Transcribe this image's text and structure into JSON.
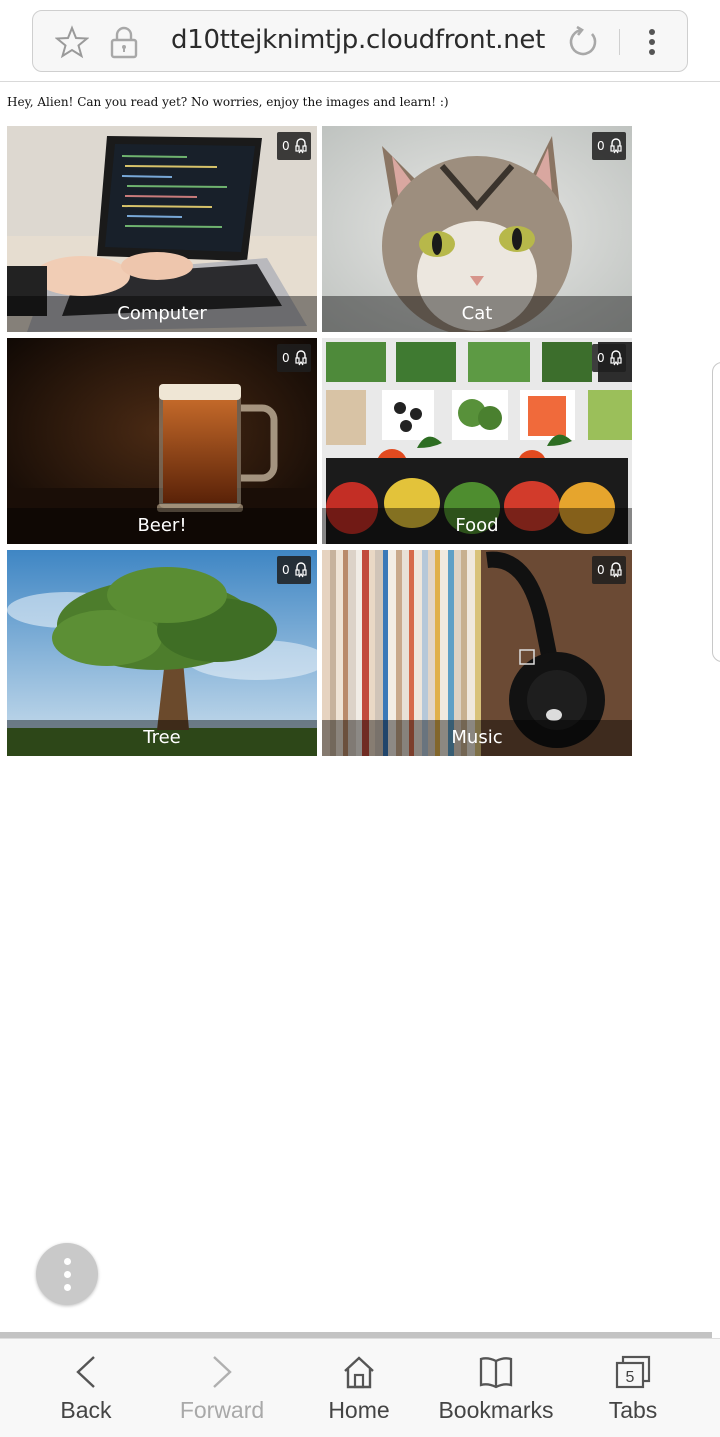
{
  "browser": {
    "url": "d10ttejknimtjp.cloudfront.net"
  },
  "page": {
    "greeting": "Hey, Alien! Can you read yet? No worries, enjoy the images and learn! :)",
    "tiles": [
      {
        "label": "Computer",
        "count": "0"
      },
      {
        "label": "Cat",
        "count": "0"
      },
      {
        "label": "Beer!",
        "count": "0"
      },
      {
        "label": "Food",
        "count": "0"
      },
      {
        "label": "Tree",
        "count": "0"
      },
      {
        "label": "Music",
        "count": "0"
      }
    ]
  },
  "bottom_nav": {
    "back": "Back",
    "forward": "Forward",
    "home": "Home",
    "bookmarks": "Bookmarks",
    "tabs": "Tabs",
    "tab_count": "5"
  }
}
